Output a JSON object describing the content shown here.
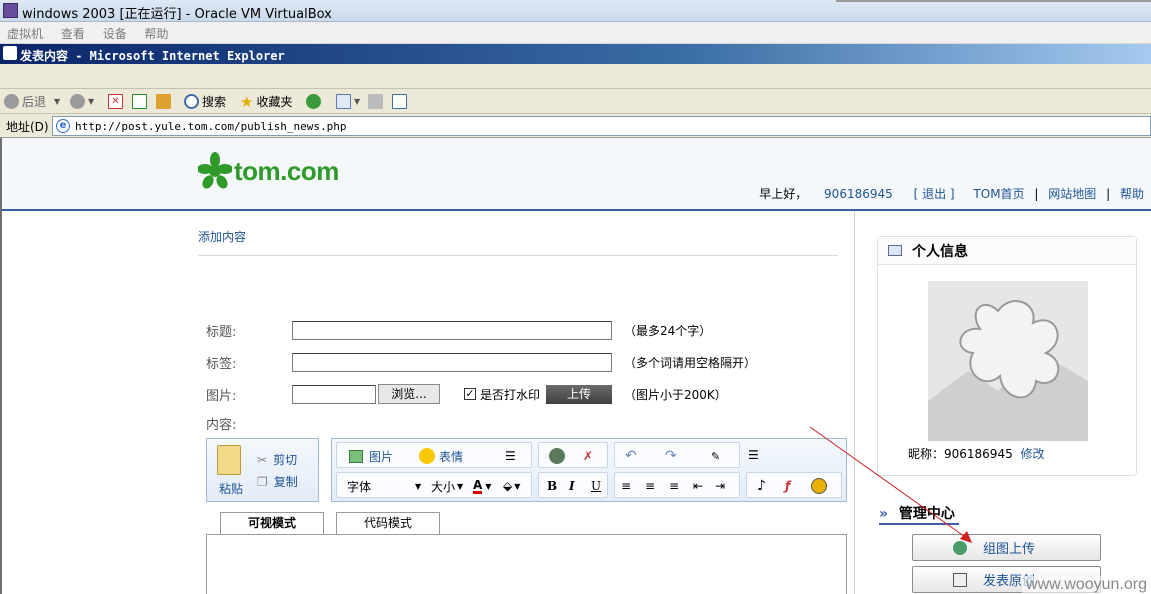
{
  "vbox": {
    "title": "windows 2003 [正在运行] - Oracle VM VirtualBox",
    "menu": [
      "虚拟机",
      "查看",
      "设备",
      "帮助"
    ]
  },
  "ie": {
    "title": "发表内容 - Microsoft Internet Explorer",
    "toolbar": {
      "back": "后退",
      "search": "搜索",
      "favorites": "收藏夹"
    },
    "address_label": "地址(D)",
    "url": "http://post.yule.tom.com/publish_news.php"
  },
  "site": {
    "logo_text": "tom.com",
    "greeting": "早上好，",
    "username": "906186945",
    "logout": "[ 退出 ]",
    "nav": [
      "TOM首页",
      "网站地图",
      "帮助"
    ],
    "separator": "|"
  },
  "form": {
    "breadcrumb": "添加内容",
    "title_label": "标题:",
    "title_value": "",
    "title_hint": "（最多24个字）",
    "tags_label": "标签:",
    "tags_value": "",
    "tags_hint": "（多个词请用空格隔开）",
    "image_label": "图片:",
    "browse": "浏览...",
    "watermark_check": "是否打水印",
    "watermark_checked": true,
    "upload": "上传",
    "image_hint": "（图片小于200K）",
    "content_label": "内容:"
  },
  "editor": {
    "paste": "粘贴",
    "cut": "剪切",
    "copy": "复制",
    "image": "图片",
    "emoticon": "表情",
    "font": "字体",
    "size": "大小",
    "bold": "B",
    "italic": "I",
    "underline": "U",
    "tab_visual": "可视模式",
    "tab_code": "代码模式"
  },
  "sidebar": {
    "info_title": "个人信息",
    "nick_label": "昵称：906186945",
    "modify": "修改",
    "mgr_title": "管理中心",
    "btn_group_upload": "组图上传",
    "btn_publish_original": "发表原创"
  },
  "watermark": "www.wooyun.org",
  "colors": {
    "brand_green": "#2f9a2a",
    "link_blue": "#1e5496",
    "header_rule": "#3b5da1"
  }
}
